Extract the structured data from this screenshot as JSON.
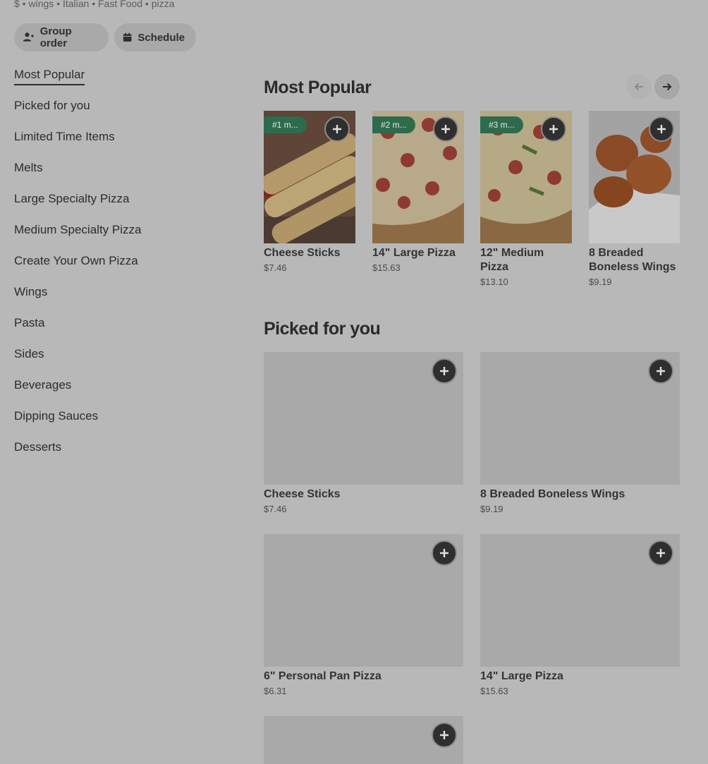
{
  "store": {
    "tags": "$ • wings • Italian • Fast Food • pizza"
  },
  "actions": {
    "group_order": "Group order",
    "schedule": "Schedule"
  },
  "categories": [
    "Most Popular",
    "Picked for you",
    "Limited Time Items",
    "Melts",
    "Large Specialty Pizza",
    "Medium Specialty Pizza",
    "Create Your Own Pizza",
    "Wings",
    "Pasta",
    "Sides",
    "Beverages",
    "Dipping Sauces",
    "Desserts"
  ],
  "most_popular": {
    "title": "Most Popular",
    "items": [
      {
        "rank": "#1 m...",
        "name": "Cheese Sticks",
        "price": "$7.46"
      },
      {
        "rank": "#2 m...",
        "name": "14\" Large Pizza",
        "price": "$15.63"
      },
      {
        "rank": "#3 m...",
        "name": "12\" Medium Pizza",
        "price": "$13.10"
      },
      {
        "rank": "",
        "name": "8 Breaded Boneless Wings",
        "price": "$9.19"
      }
    ]
  },
  "picked_for_you": {
    "title": "Picked for you",
    "items": [
      {
        "name": "Cheese Sticks",
        "price": "$7.46"
      },
      {
        "name": "8 Breaded Boneless Wings",
        "price": "$9.19"
      },
      {
        "name": "6\" Personal Pan Pizza",
        "price": "$6.31"
      },
      {
        "name": "14\" Large Pizza",
        "price": "$15.63"
      },
      {
        "name": "",
        "price": ""
      }
    ]
  },
  "icons": {
    "group_order": "add-person-icon",
    "schedule": "calendar-icon",
    "prev": "arrow-left-icon",
    "next": "arrow-right-icon",
    "add": "plus-icon"
  }
}
